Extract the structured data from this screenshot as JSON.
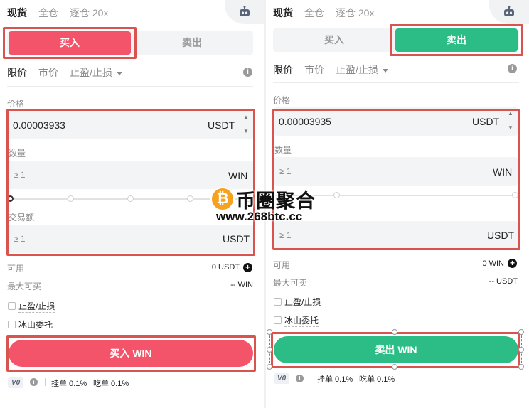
{
  "tabs": [
    "现货",
    "全仓",
    "逐仓 20x"
  ],
  "order_types": [
    "限价",
    "市价",
    "止盈/止损"
  ],
  "left": {
    "side_buy": "买入",
    "side_sell": "卖出",
    "price_label": "价格",
    "price_value": "0.00003933",
    "price_unit": "USDT",
    "amount_label": "数量",
    "amount_placeholder": "≥ 1",
    "amount_unit": "WIN",
    "total_label": "交易额",
    "total_placeholder": "≥ 1",
    "total_unit": "USDT",
    "avail_label": "可用",
    "avail_value": "0 USDT",
    "max_label": "最大可买",
    "max_value": "-- WIN",
    "tp_sl": "止盈/止损",
    "iceberg": "冰山委托",
    "action": "买入 WIN",
    "slider_percent": 0
  },
  "right": {
    "side_buy": "买入",
    "side_sell": "卖出",
    "price_label": "价格",
    "price_value": "0.00003935",
    "price_unit": "USDT",
    "amount_label": "数量",
    "amount_placeholder": "≥ 1",
    "amount_unit": "WIN",
    "total_placeholder": "≥ 1",
    "total_unit": "USDT",
    "avail_label": "可用",
    "avail_value": "0 WIN",
    "max_label": "最大可卖",
    "max_value": "-- USDT",
    "tp_sl": "止盈/止损",
    "iceberg": "冰山委托",
    "action": "卖出 WIN"
  },
  "fees": {
    "vip": "V0",
    "maker": "挂单 0.1%",
    "taker": "吃单 0.1%"
  },
  "watermark": {
    "coin": "₿",
    "title": "币圈聚合",
    "url": "www.268btc.cc"
  },
  "colors": {
    "buy": "#f4546a",
    "sell": "#2bbd85",
    "highlight": "#d9534f"
  }
}
